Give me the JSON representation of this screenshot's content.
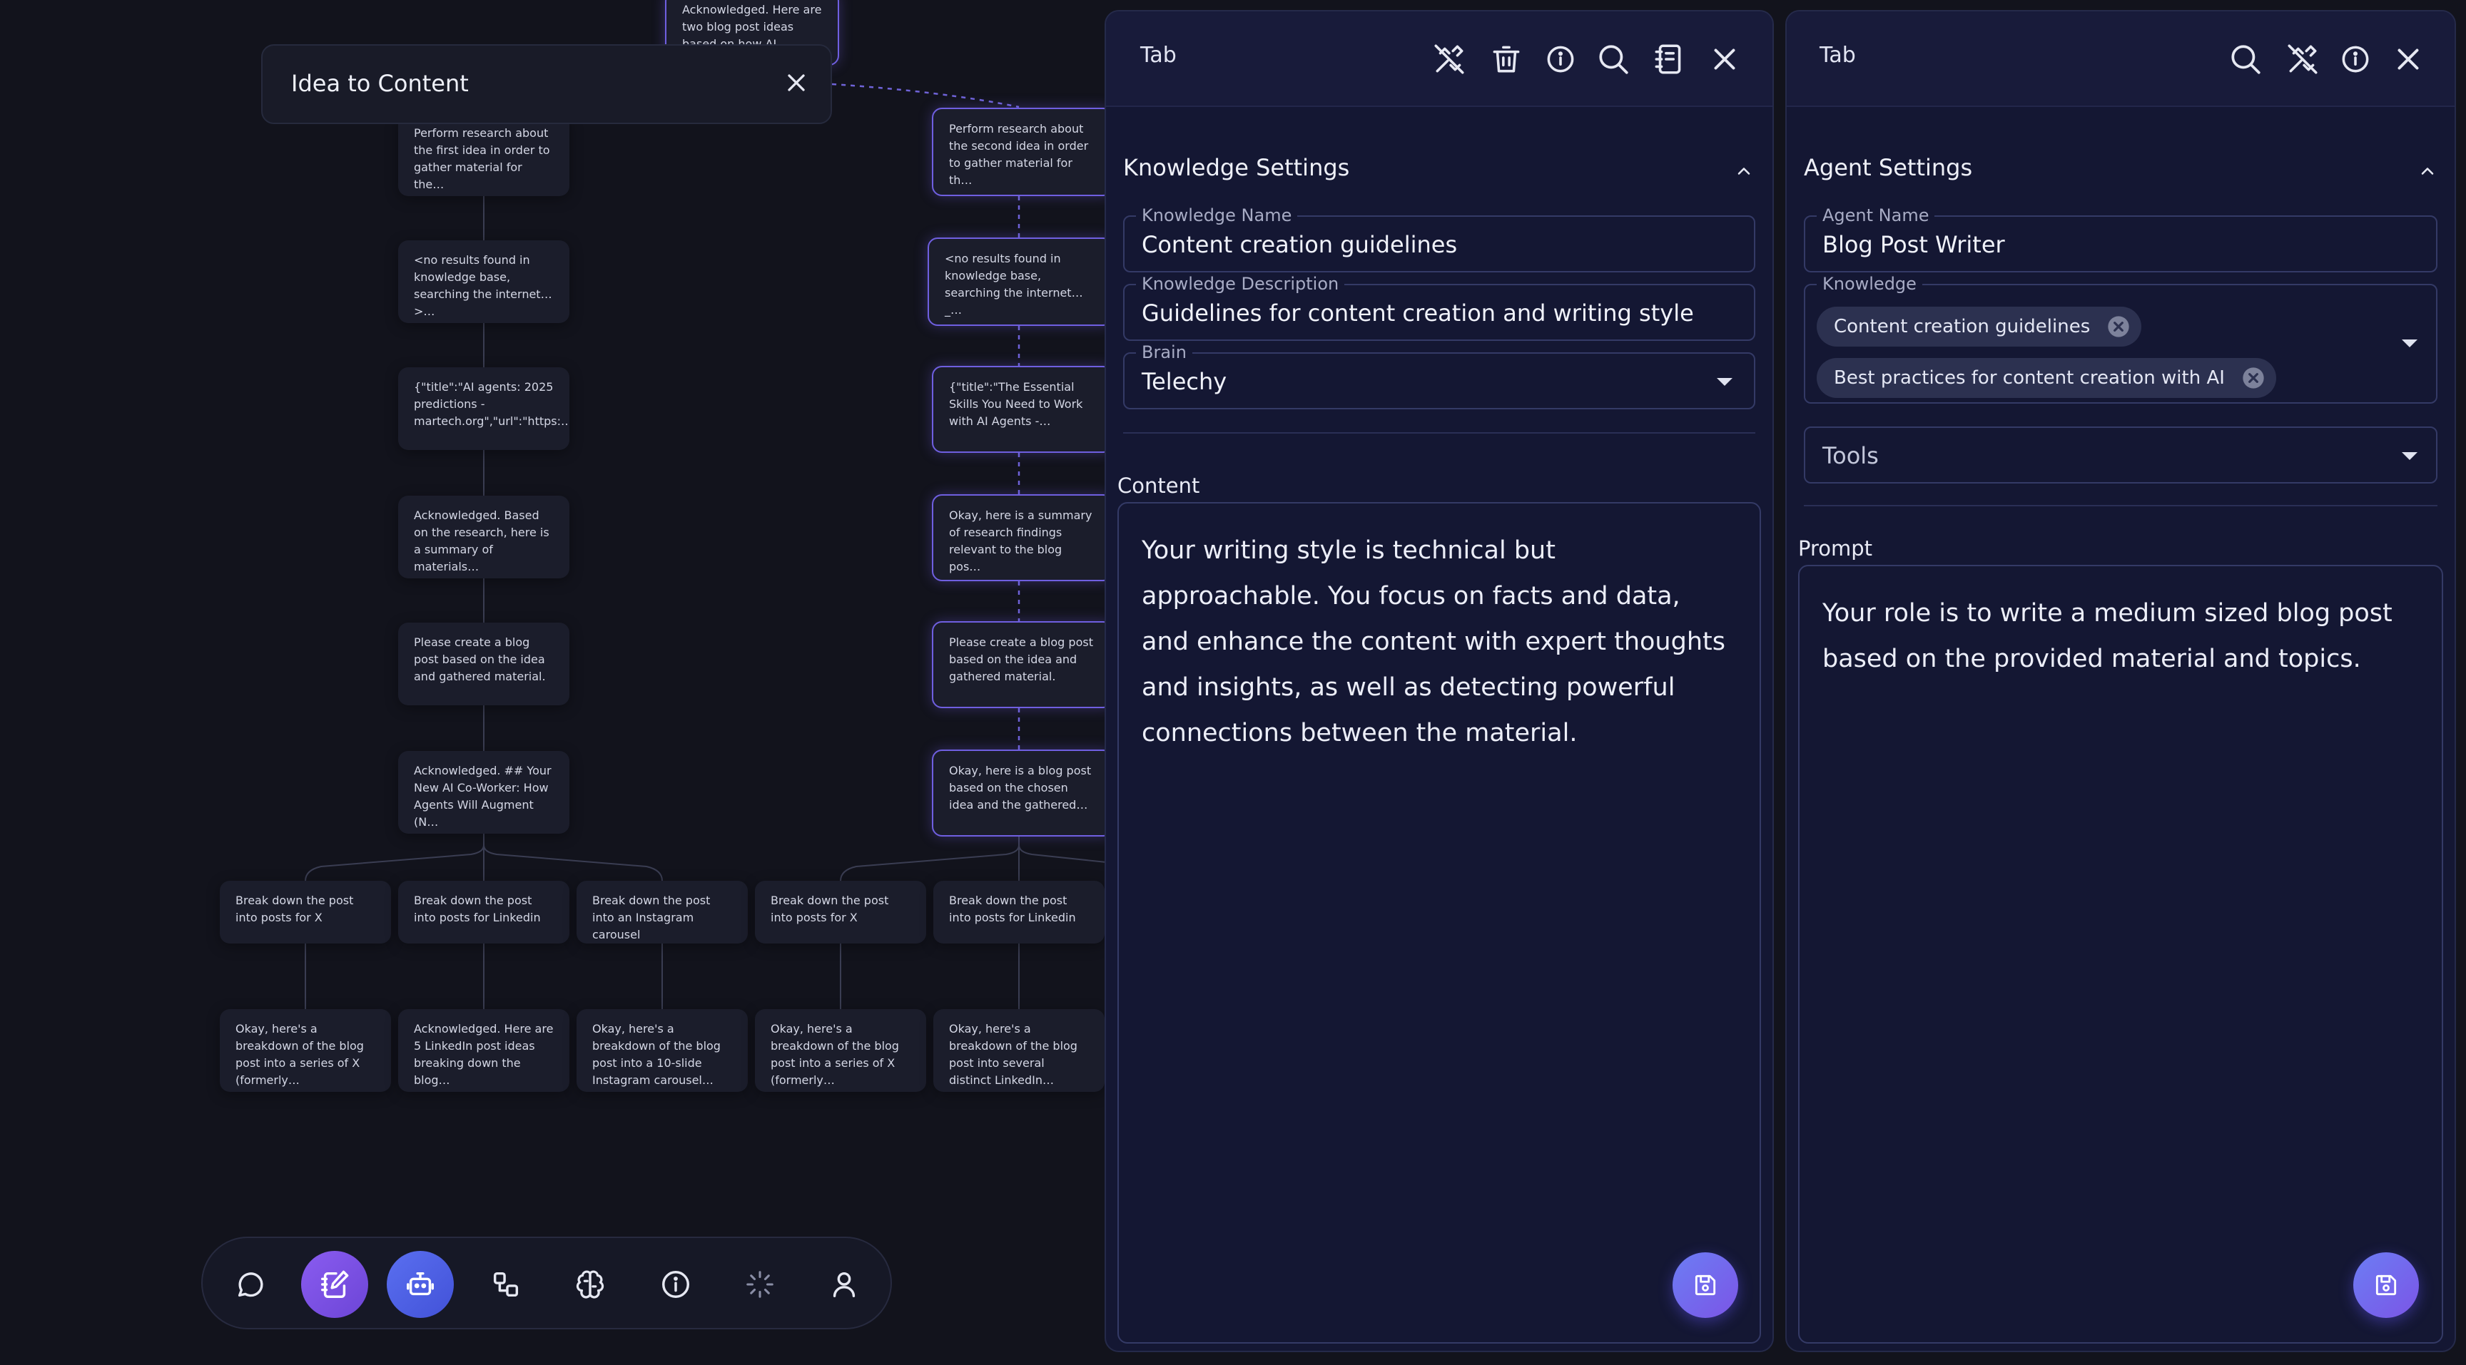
{
  "workflow": {
    "title": "Idea to Content",
    "nodes": {
      "top": "Acknowledged. Here are two blog post ideas based on how AI agents…",
      "left": [
        "Perform research about the first idea in order to gather material for the…",
        "<no results found in knowledge base, searching the internet…>…",
        "{\"title\":\"AI agents: 2025 predictions - martech.org\",\"url\":\"https:…",
        "Acknowledged. Based on the research, here is a summary of materials…",
        "Please create a blog post based on the idea and gathered material.",
        "Acknowledged. ## Your New AI Co-Worker: How Agents Will Augment (N…"
      ],
      "right": [
        "Perform research about the second idea in order to gather material for th…",
        "<no results found in knowledge base, searching the internet…_…",
        "{\"title\":\"The Essential Skills You Need to Work with AI Agents -…",
        "Okay, here is a summary of research findings relevant to the blog pos…",
        "Please create a blog post based on the idea and gathered material.",
        "Okay, here is a blog post based on the chosen idea and the gathered…"
      ],
      "breakdown": [
        "Break down the post into posts for X",
        "Break down the post into posts for Linkedin",
        "Break down the post into an Instagram carousel",
        "Break down the post into posts for X",
        "Break down the post into posts for Linkedin"
      ],
      "results": [
        "Okay, here's a breakdown of the blog post into a series of X (formerly…",
        "Acknowledged. Here are 5 LinkedIn post ideas breaking down the blog…",
        "Okay, here's a breakdown of the blog post into a 10-slide Instagram carousel…",
        "Okay, here's a breakdown of the blog post into a series of X (formerly…",
        "Okay, here's a breakdown of the blog post into several distinct LinkedIn…"
      ]
    }
  },
  "toolbar": {
    "items": [
      {
        "icon": "chat-icon",
        "active": false
      },
      {
        "icon": "notebook-edit-icon",
        "active": true,
        "color": "#7b52e0"
      },
      {
        "icon": "robot-icon",
        "active": true,
        "color": "#4a5fe0"
      },
      {
        "icon": "shapes-icon",
        "active": false
      },
      {
        "icon": "brain-icon",
        "active": false
      },
      {
        "icon": "info-icon",
        "active": false
      },
      {
        "icon": "loader-icon",
        "active": false
      },
      {
        "icon": "user-icon",
        "active": false
      }
    ]
  },
  "knowledge_panel": {
    "tab_label": "Tab",
    "header_icons": [
      "tools-off-icon",
      "trash-icon",
      "info-icon",
      "search-icon",
      "notebook-icon",
      "close-icon"
    ],
    "section_title": "Knowledge Settings",
    "name_label": "Knowledge Name",
    "name_value": "Content creation guidelines",
    "description_label": "Knowledge Description",
    "description_value": "Guidelines for content creation and writing style",
    "brain_label": "Brain",
    "brain_value": "Telechy",
    "content_label": "Content",
    "content_text": "Your writing style is technical but approachable. You focus on facts and data, and enhance the content with expert thoughts and insights, as well as detecting powerful connections between the material."
  },
  "agent_panel": {
    "tab_label": "Tab",
    "header_icons": [
      "search-icon",
      "tools-off-icon",
      "info-icon",
      "close-icon"
    ],
    "section_title": "Agent Settings",
    "name_label": "Agent Name",
    "name_value": "Blog Post Writer",
    "knowledge_label": "Knowledge",
    "knowledge_chips": [
      "Content creation guidelines",
      "Best practices for content creation with AI"
    ],
    "tools_placeholder": "Tools",
    "prompt_label": "Prompt",
    "prompt_text": "Your role is to write a medium sized blog post based on the provided material and topics."
  },
  "colors": {
    "background": "#12131c",
    "panel": "#141733",
    "accent_purple": "#7b52e0",
    "accent_blue": "#4a5fe0",
    "selected_border": "#6f5fe0"
  }
}
